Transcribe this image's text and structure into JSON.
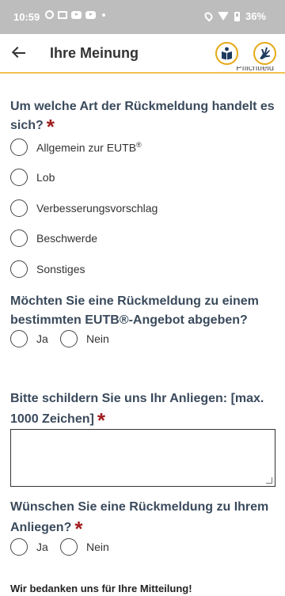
{
  "status_bar": {
    "time": "10:59",
    "battery_percent": "36%",
    "left_icons": [
      "circle-app-icon",
      "gmail-icon",
      "youtube-icon",
      "youtube-icon",
      "notification-dot-icon"
    ],
    "right_icons": [
      "location-icon",
      "wifi-icon",
      "battery-icon"
    ]
  },
  "app_bar": {
    "title": "Ihre Meinung",
    "back_icon": "arrow-back-icon",
    "buttons": [
      "easy-language-icon",
      "sign-language-icon"
    ],
    "accent_color": "#e6a817"
  },
  "cut_off_text": "Pflichtfeld",
  "form": {
    "q1": {
      "label": "Um welche Art der Rückmeldung handelt es sich?",
      "required_mark": "*",
      "options": [
        {
          "label": "Allgemein zur EUTB",
          "suffix": "®"
        },
        {
          "label": "Lob"
        },
        {
          "label": "Verbesserungsvorschlag"
        },
        {
          "label": "Beschwerde"
        },
        {
          "label": "Sonstiges"
        }
      ]
    },
    "q2": {
      "label": "Möchten Sie eine Rückmeldung zu einem bestimmten EUTB®-Angebot abgeben?",
      "options": [
        "Ja",
        "Nein"
      ]
    },
    "q3": {
      "label": "Bitte schildern Sie uns Ihr Anliegen: [max. 1000 Zeichen]",
      "required_mark": "*",
      "value": ""
    },
    "q4": {
      "label": "Wünschen Sie eine Rückmeldung zu Ihrem Anliegen?",
      "required_mark": "*",
      "options": [
        "Ja",
        "Nein"
      ]
    }
  },
  "footer_text": "Wir bedanken uns für Ihre Mitteilung!",
  "colors": {
    "question_text": "#3a4a5c",
    "required_star": "#a11d1d",
    "status_bar_bg": "#bdbdbd"
  }
}
